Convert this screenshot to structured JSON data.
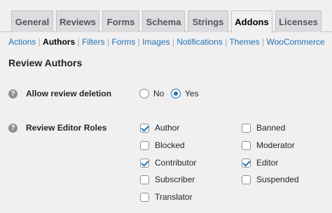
{
  "tabs": [
    {
      "label": "General",
      "active": false
    },
    {
      "label": "Reviews",
      "active": false
    },
    {
      "label": "Forms",
      "active": false
    },
    {
      "label": "Schema",
      "active": false
    },
    {
      "label": "Strings",
      "active": false
    },
    {
      "label": "Addons",
      "active": true
    },
    {
      "label": "Licenses",
      "active": false
    }
  ],
  "subnav": {
    "items": [
      "Actions",
      "Authors",
      "Filters",
      "Forms",
      "Images",
      "Notifications",
      "Themes",
      "WooCommerce"
    ],
    "current": "Authors",
    "separator": "|"
  },
  "section_title": "Review Authors",
  "allow_deletion": {
    "label": "Allow review deletion",
    "options": [
      {
        "label": "No",
        "checked": false
      },
      {
        "label": "Yes",
        "checked": true
      }
    ]
  },
  "editor_roles": {
    "label": "Review Editor Roles",
    "col1": [
      {
        "label": "Author",
        "checked": true
      },
      {
        "label": "Blocked",
        "checked": false
      },
      {
        "label": "Contributor",
        "checked": true
      },
      {
        "label": "Subscriber",
        "checked": false
      },
      {
        "label": "Translator",
        "checked": false
      }
    ],
    "col2": [
      {
        "label": "Banned",
        "checked": false
      },
      {
        "label": "Moderator",
        "checked": false
      },
      {
        "label": "Editor",
        "checked": true
      },
      {
        "label": "Suspended",
        "checked": false
      }
    ]
  },
  "help_icon_glyph": "?",
  "colors": {
    "link": "#2271b1",
    "accent": "#2271b1",
    "background": "#f0f0f1"
  }
}
